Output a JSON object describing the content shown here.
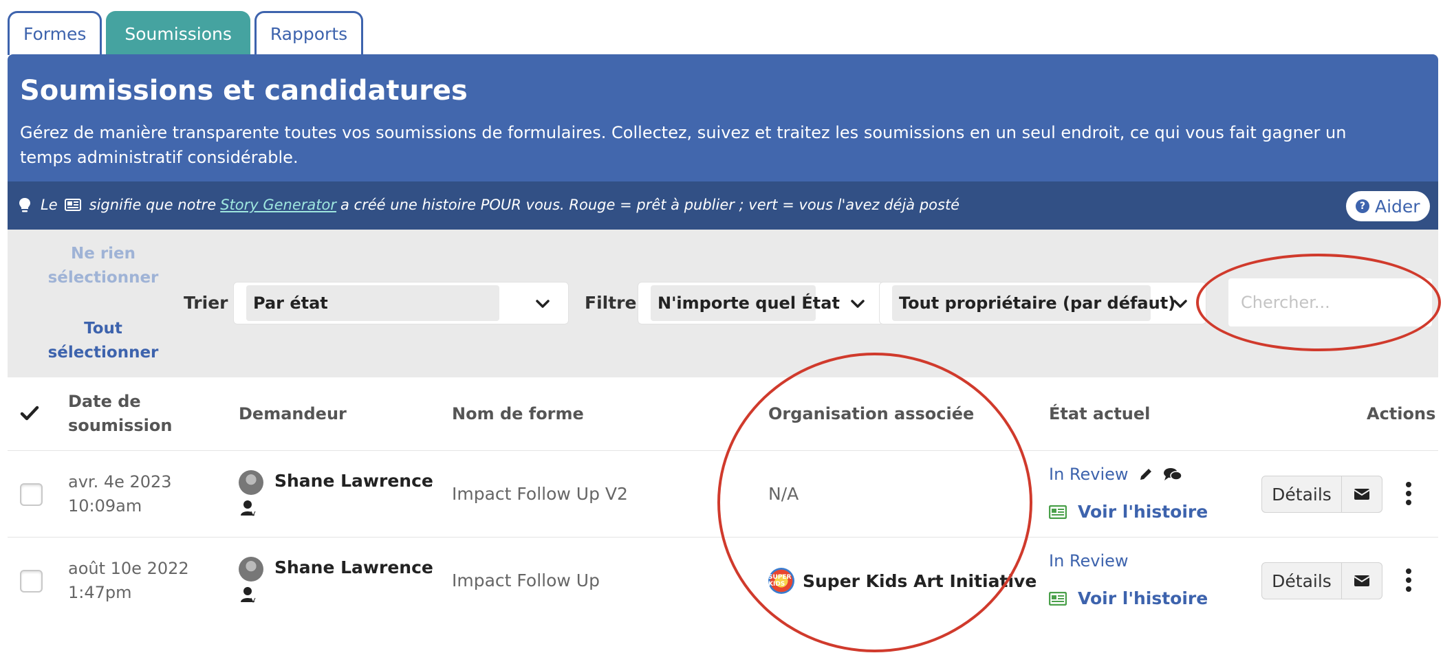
{
  "tabs": [
    {
      "label": "Formes",
      "active": false
    },
    {
      "label": "Soumissions",
      "active": true
    },
    {
      "label": "Rapports",
      "active": false
    }
  ],
  "header": {
    "title": "Soumissions et candidatures",
    "description": "Gérez de manière transparente toutes vos soumissions de formulaires. Collectez, suivez et traitez les soumissions en un seul endroit, ce qui vous fait gagner un temps administratif considérable."
  },
  "tip": {
    "prefix": "Le",
    "middle": "signifie que notre",
    "link": "Story Generator",
    "suffix": "a créé une histoire POUR vous. Rouge = prêt à publier ; vert = vous l'avez déjà posté",
    "help_label": "Aider"
  },
  "controls": {
    "select_none": "Ne rien sélectionner",
    "select_all": "Tout sélectionner",
    "sort_label": "Trier",
    "sort_value": "Par état",
    "filter_label": "Filtre",
    "filter_state_value": "N'importe quel État",
    "filter_owner_value": "Tout propriétaire (par défaut)",
    "search_placeholder": "Chercher..."
  },
  "table": {
    "columns": {
      "date": "Date de soumission",
      "requester": "Demandeur",
      "form": "Nom de forme",
      "org": "Organisation associée",
      "state": "État actuel",
      "actions": "Actions"
    },
    "rows": [
      {
        "date_line1": "avr. 4e 2023",
        "date_line2": "10:09am",
        "requester": "Shane Lawrence",
        "form": "Impact Follow Up V2",
        "org": "N/A",
        "state": "In Review",
        "story": "Voir l'histoire",
        "details": "Détails"
      },
      {
        "date_line1": "août 10e 2022",
        "date_line2": "1:47pm",
        "requester": "Shane Lawrence",
        "form": "Impact Follow Up",
        "org": "Super Kids Art Initiative",
        "org_logo_text": "SUPER KIDS",
        "state": "In Review",
        "story": "Voir l'histoire",
        "details": "Détails"
      }
    ]
  },
  "colors": {
    "primary_blue": "#4267ad",
    "dark_blue": "#325085",
    "teal_tab": "#45a3a0",
    "annotation_red": "#d03a2c",
    "story_green": "#4aa04a"
  }
}
